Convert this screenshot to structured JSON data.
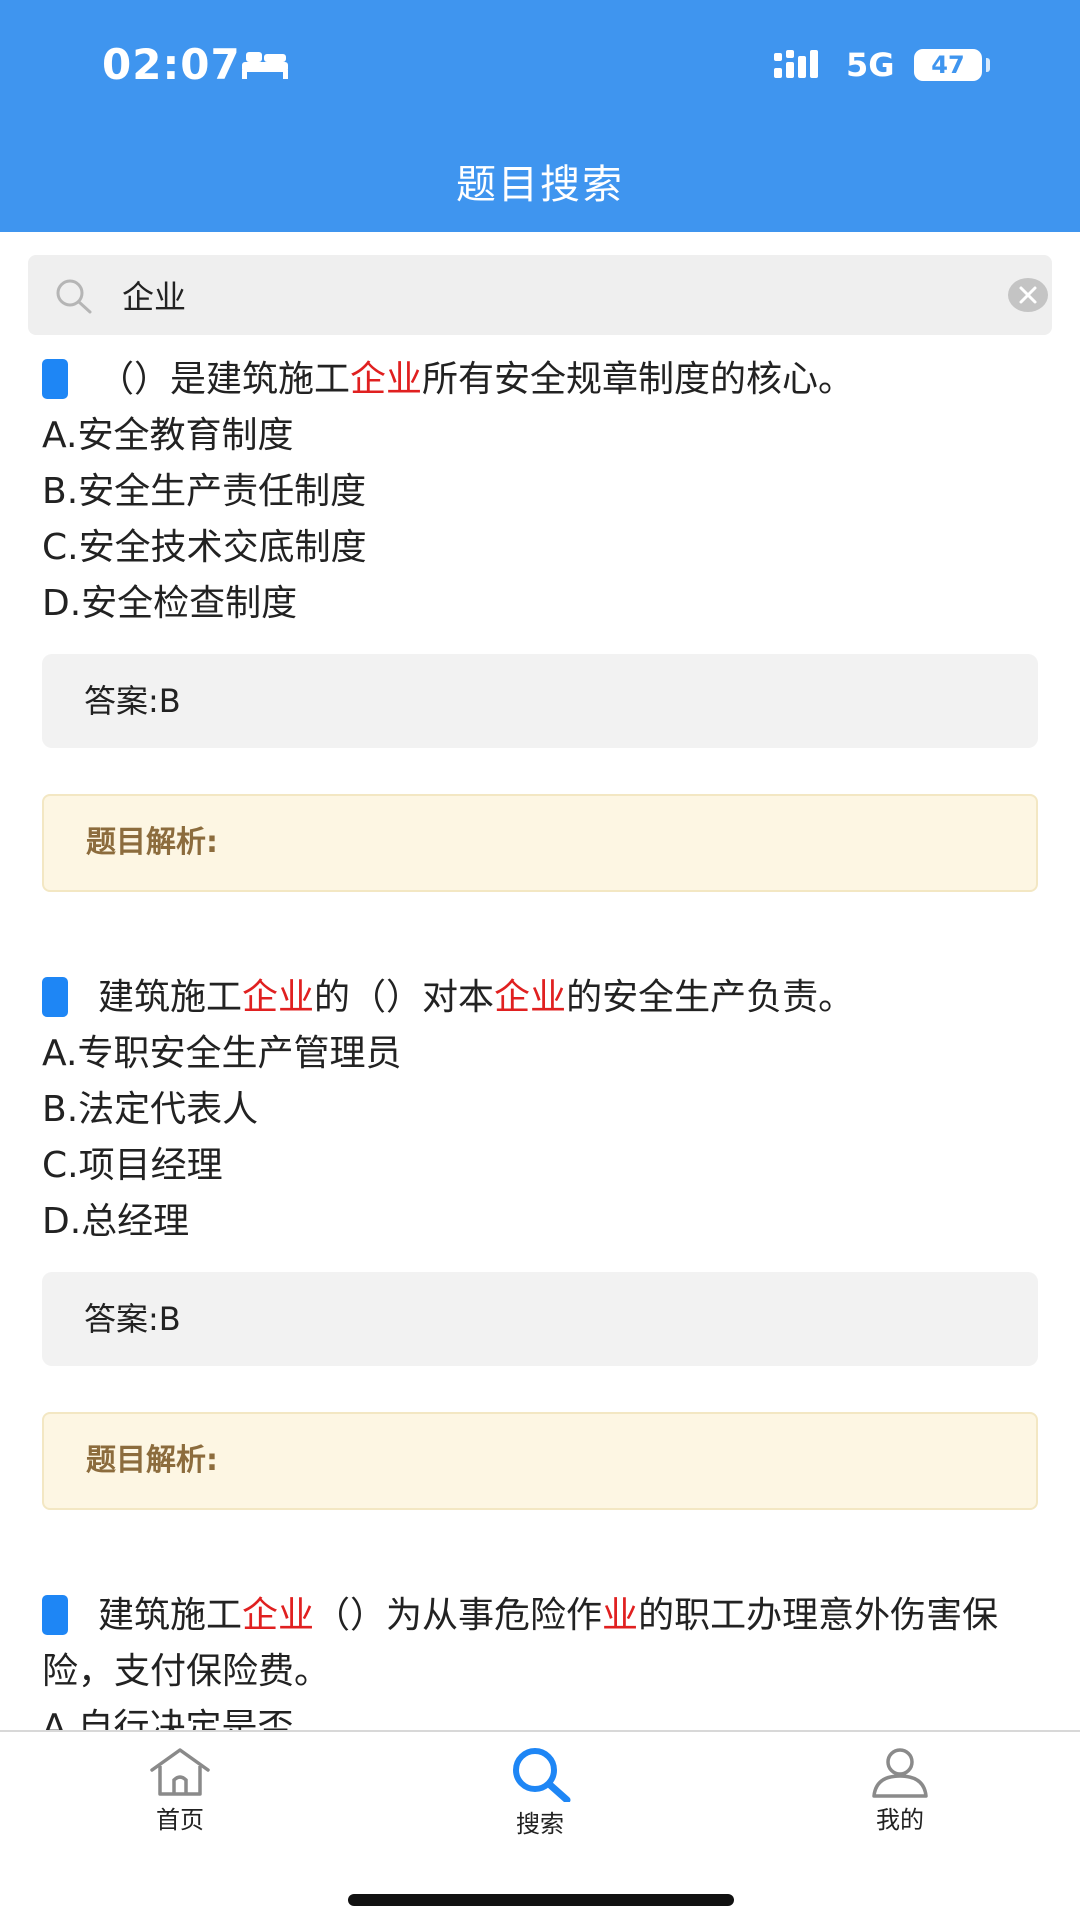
{
  "status_bar": {
    "time": "02:07",
    "network": "5G",
    "battery": "47"
  },
  "header": {
    "title": "题目搜索"
  },
  "search": {
    "value": "企业",
    "placeholder": ""
  },
  "questions": [
    {
      "segments": [
        {
          "text": "（）是建筑施工",
          "highlight": false
        },
        {
          "text": "企业",
          "highlight": true
        },
        {
          "text": "所有安全规章制度的核心。",
          "highlight": false
        }
      ],
      "options": [
        "A.安全教育制度",
        "B.安全生产责任制度",
        "C.安全技术交底制度",
        "D.安全检查制度"
      ],
      "answer": "答案:B",
      "analysis_label": "题目解析:"
    },
    {
      "segments": [
        {
          "text": "建筑施工",
          "highlight": false
        },
        {
          "text": "企业",
          "highlight": true
        },
        {
          "text": "的（）对本",
          "highlight": false
        },
        {
          "text": "企业",
          "highlight": true
        },
        {
          "text": "的安全生产负责。",
          "highlight": false
        }
      ],
      "options": [
        "A.专职安全生产管理员",
        "B.法定代表人",
        "C.项目经理",
        "D.总经理"
      ],
      "answer": "答案:B",
      "analysis_label": "题目解析:"
    },
    {
      "segments": [
        {
          "text": "建筑施工",
          "highlight": false
        },
        {
          "text": "企业",
          "highlight": true
        },
        {
          "text": "（）为从事危险作",
          "highlight": false
        },
        {
          "text": "业",
          "highlight": true
        },
        {
          "text": "的职工办理意外伤害保险，支付保险费。",
          "highlight": false
        }
      ],
      "options": [
        "A.自行决定是否"
      ],
      "answer": "",
      "analysis_label": ""
    }
  ],
  "tab_bar": {
    "items": [
      {
        "label": "首页",
        "icon": "home-icon",
        "active": false
      },
      {
        "label": "搜索",
        "icon": "search-icon",
        "active": true
      },
      {
        "label": "我的",
        "icon": "user-icon",
        "active": false
      }
    ]
  },
  "colors": {
    "header": "#3f95ef",
    "highlight": "#e02020",
    "active_tab": "#1e86f5",
    "analysis_text": "#8c6c3d"
  }
}
